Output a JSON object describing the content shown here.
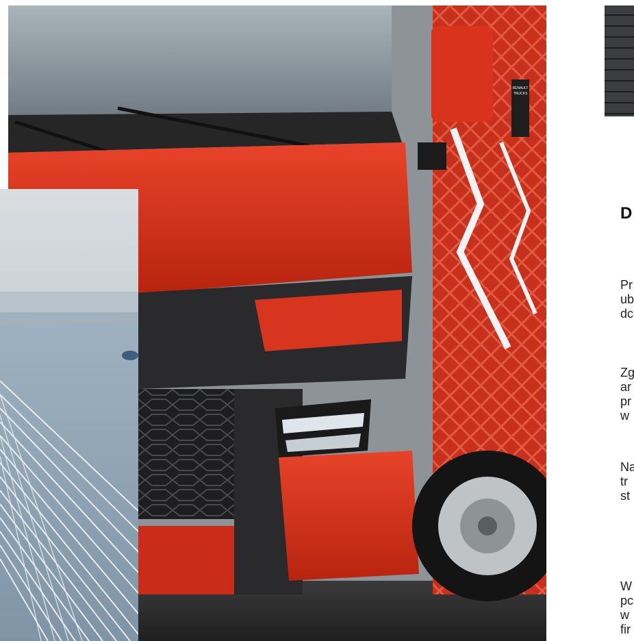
{
  "photo_truck": {
    "badge_lines": [
      "RENAULT",
      "TRUCKS"
    ]
  },
  "photo_bridge": {},
  "panel": {
    "title": "D",
    "paragraphs": [
      [
        "Pr",
        "ub",
        "dc"
      ],
      [
        "Zg",
        "ar",
        "pr",
        "w"
      ],
      [
        "Na",
        "tr",
        "st"
      ],
      [
        "W",
        "pc",
        "w",
        "fir"
      ]
    ]
  },
  "colors": {
    "truck_red": "#d8321f",
    "dark_grille": "#2a2a2c",
    "bridge_sky": "#d3d8dc",
    "text_dark": "#111111"
  }
}
